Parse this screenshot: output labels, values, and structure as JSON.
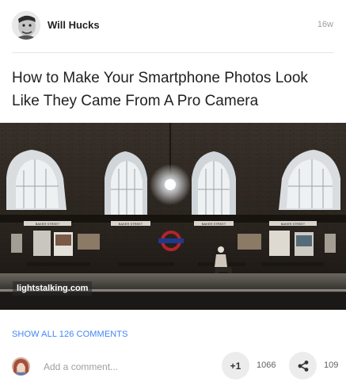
{
  "post": {
    "author": "Will Hucks",
    "timestamp": "16w",
    "title": "How to Make Your Smartphone Photos Look Like They Came From A Pro Camera",
    "image": {
      "watermark": "lightstalking.com",
      "signs": [
        "BAKER STREET",
        "BAKER STREET",
        "BAKER STREET",
        "BAKER STREET"
      ]
    }
  },
  "footer": {
    "show_comments": "SHOW ALL 126 COMMENTS",
    "comment_placeholder": "Add a comment...",
    "plusone_label": "+1",
    "plusone_count": "1066",
    "share_count": "109"
  },
  "colors": {
    "link": "#4285f4",
    "button_bg": "#ececec"
  },
  "icons": [
    "profile-avatar",
    "commenter-avatar",
    "share-icon"
  ]
}
